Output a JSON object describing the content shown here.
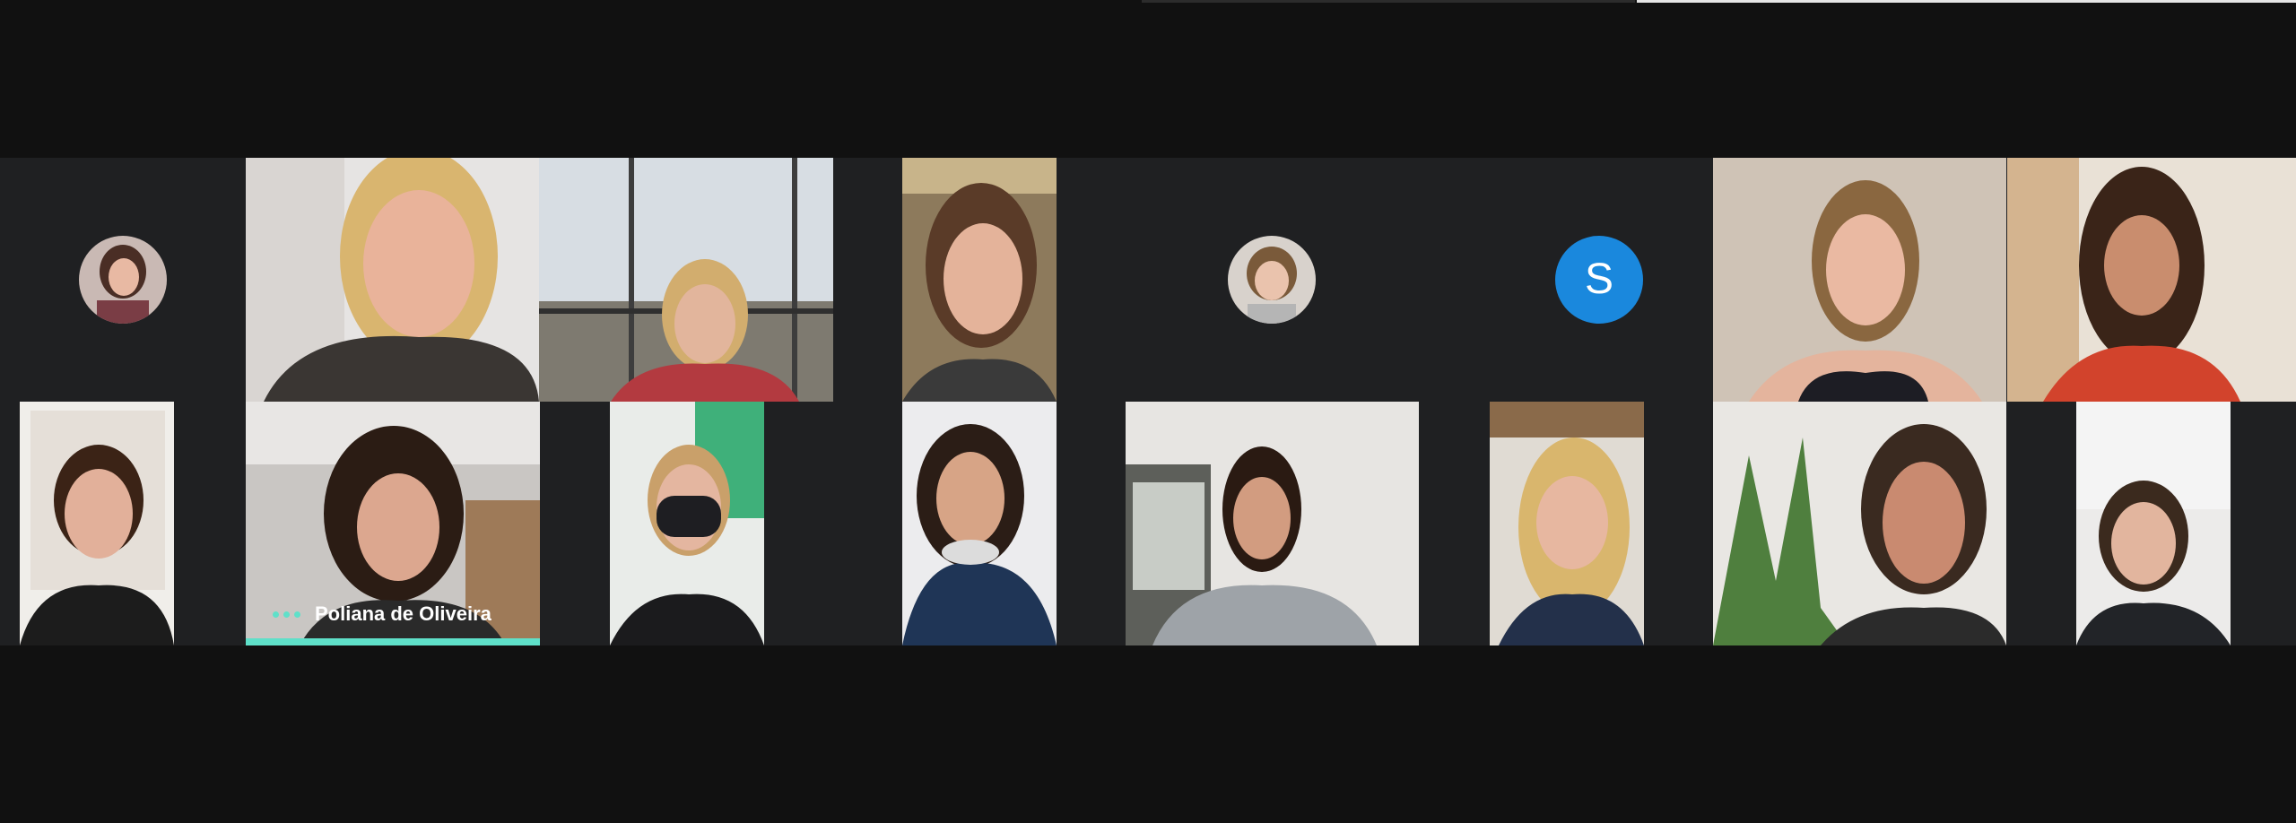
{
  "meeting": {
    "speaking_participant": "Poliana de Oliveira",
    "avatar_letter": "S",
    "colors": {
      "background": "#111111",
      "grid_background": "#1f2022",
      "speaking_indicator": "#5fe0c9",
      "avatar_letter_bg": "#1a88dd"
    }
  }
}
